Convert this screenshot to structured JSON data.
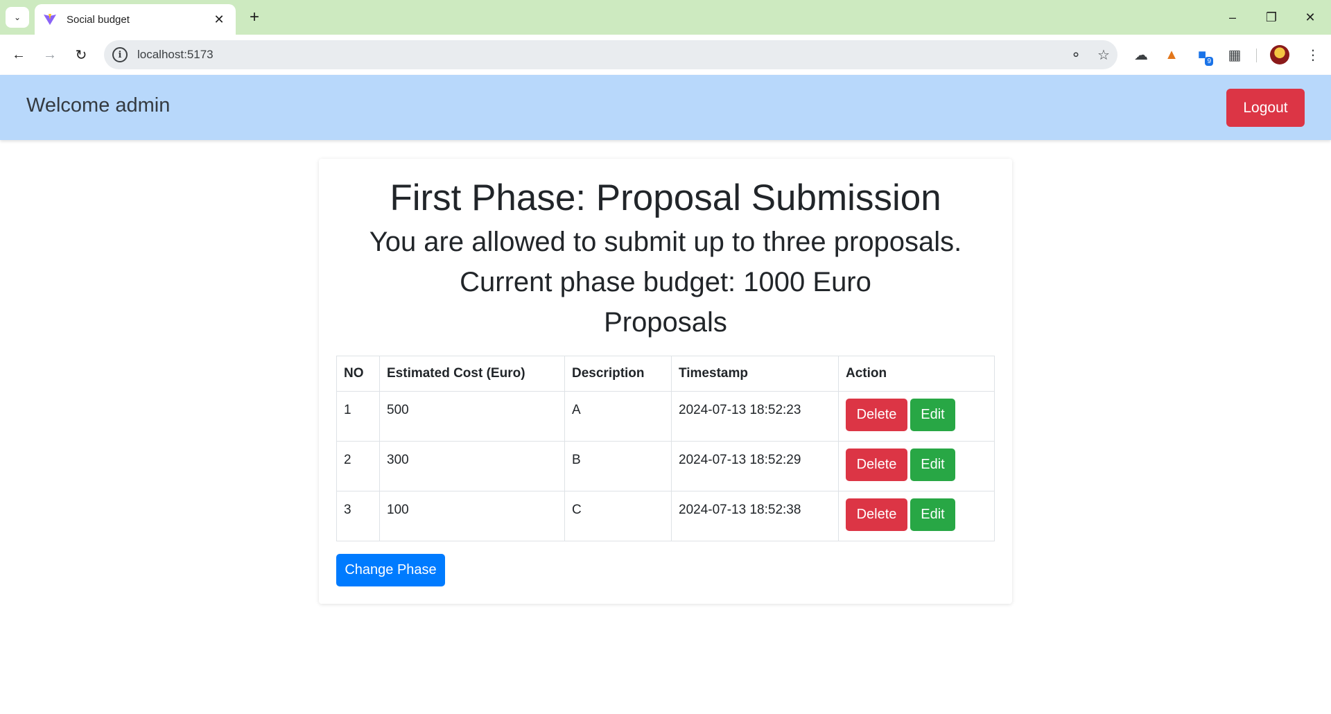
{
  "browser": {
    "tab_title": "Social budget",
    "url": "localhost:5173",
    "extension_badge": "9"
  },
  "header": {
    "welcome": "Welcome admin",
    "logout_label": "Logout"
  },
  "main": {
    "title": "First Phase: Proposal Submission",
    "subtitle": "You are allowed to submit up to three proposals.",
    "budget": "Current phase budget: 1000 Euro",
    "proposals_heading": "Proposals",
    "table": {
      "headers": [
        "NO",
        "Estimated Cost (Euro)",
        "Description",
        "Timestamp",
        "Action"
      ],
      "rows": [
        {
          "no": "1",
          "cost": "500",
          "description": "A",
          "timestamp": "2024-07-13 18:52:23"
        },
        {
          "no": "2",
          "cost": "300",
          "description": "B",
          "timestamp": "2024-07-13 18:52:29"
        },
        {
          "no": "3",
          "cost": "100",
          "description": "C",
          "timestamp": "2024-07-13 18:52:38"
        }
      ],
      "delete_label": "Delete",
      "edit_label": "Edit"
    },
    "change_phase_label": "Change Phase"
  },
  "colors": {
    "header_bg": "#b8d8fb",
    "danger": "#dc3545",
    "success": "#28a745",
    "primary": "#007bff",
    "tabbar_bg": "#cdeac0"
  }
}
